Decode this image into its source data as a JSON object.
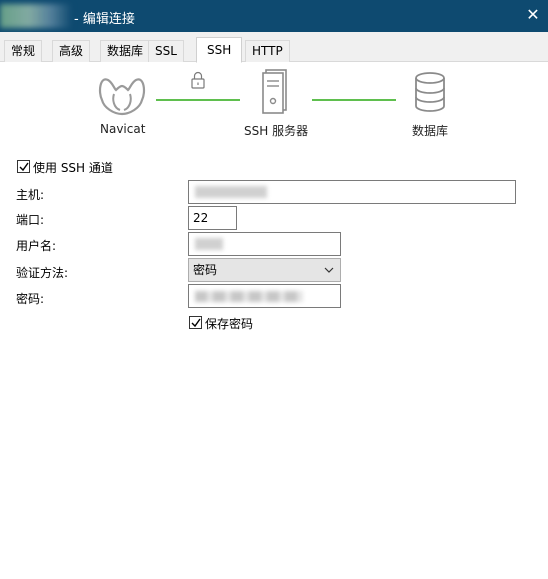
{
  "window": {
    "title": "- 编辑连接",
    "close_glyph": "✕"
  },
  "tabs": [
    {
      "label": "常规",
      "active": false
    },
    {
      "label": "高级",
      "active": false
    },
    {
      "label": "数据库",
      "active": false
    },
    {
      "label": "SSL",
      "active": false
    },
    {
      "label": "SSH",
      "active": true
    },
    {
      "label": "HTTP",
      "active": false
    }
  ],
  "diagram": {
    "client_label": "Navicat",
    "server_label": "SSH 服务器",
    "db_label": "数据库",
    "line_color": "#5fbf4e",
    "icon_color": "#8a8a8a"
  },
  "form": {
    "use_ssh_label": "使用 SSH 通道",
    "use_ssh_checked": true,
    "host_label": "主机:",
    "port_label": "端口:",
    "port_value": "22",
    "username_label": "用户名:",
    "auth_label": "验证方法:",
    "auth_value": "密码",
    "password_label": "密码:",
    "save_password_label": "保存密码",
    "save_password_checked": true
  }
}
